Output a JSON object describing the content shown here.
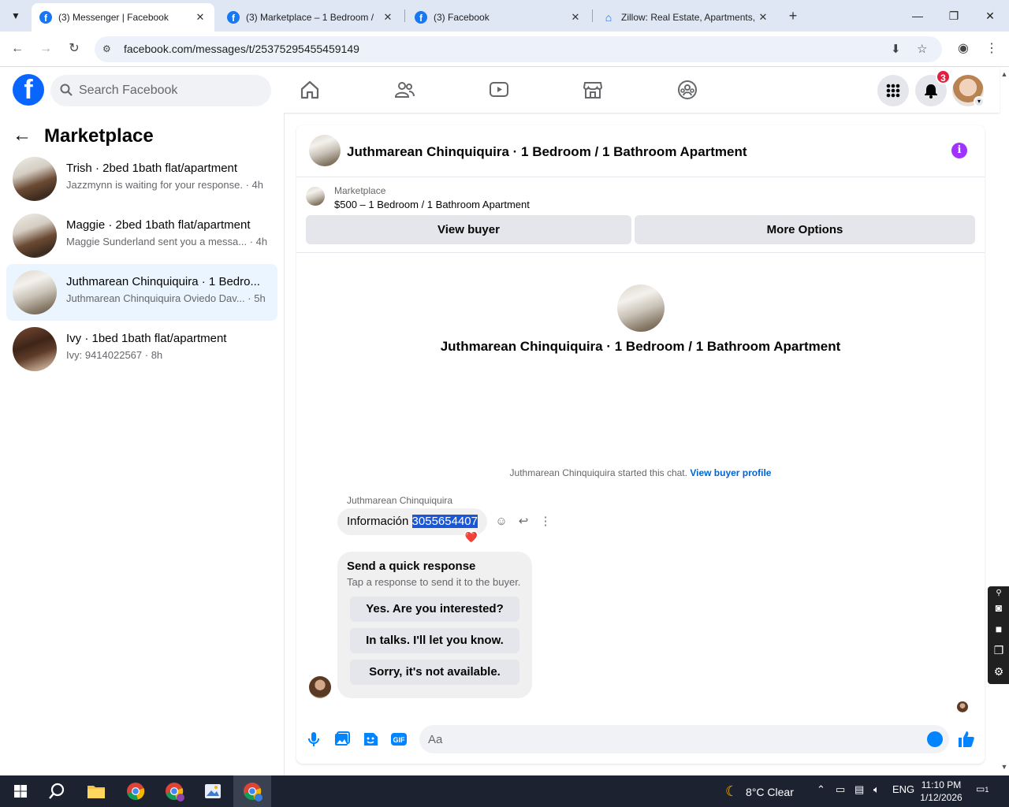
{
  "browser": {
    "tabs": [
      {
        "title": "(3) Messenger | Facebook",
        "favicon": "facebook-icon",
        "active": true
      },
      {
        "title": "(3) Marketplace – 1 Bedroom /",
        "favicon": "facebook-icon",
        "active": false
      },
      {
        "title": "(3) Facebook",
        "favicon": "facebook-icon",
        "active": false
      },
      {
        "title": "Zillow: Real Estate, Apartments,",
        "favicon": "zillow-icon",
        "active": false
      }
    ],
    "url": "facebook.com/messages/t/25375295455459149"
  },
  "fb_header": {
    "search_placeholder": "Search Facebook",
    "notification_count": "3",
    "brand_color": "#0866ff"
  },
  "sidebar": {
    "title": "Marketplace",
    "conversations": [
      {
        "name": "Trish · 2bed 1bath flat/apartment",
        "preview": "Jazzmynn is waiting for your response. · 4h"
      },
      {
        "name": "Maggie · 2bed 1bath flat/apartment",
        "preview": "Maggie Sunderland sent you a messa... · 4h"
      },
      {
        "name": "Juthmarean Chinquiquira · 1 Bedro...",
        "preview": "Juthmarean Chinquiquira Oviedo Dav... · 5h"
      },
      {
        "name": "Ivy · 1bed 1bath flat/apartment",
        "preview": "Ivy: 9414022567 · 8h"
      }
    ]
  },
  "chat": {
    "title": "Juthmarean Chinquiquira · 1 Bedroom / 1 Bathroom Apartment",
    "listing_category": "Marketplace",
    "listing_price": "$500 – 1 Bedroom / 1 Bathroom Apartment",
    "view_buyer_label": "View buyer",
    "more_options_label": "More Options",
    "center_title": "Juthmarean Chinquiquira · 1 Bedroom / 1 Bathroom Apartment",
    "started_text": "Juthmarean Chinquiquira started this chat.",
    "view_buyer_profile_label": "View buyer profile",
    "sender_name": "Juthmarean Chinquiquira",
    "message_prefix": "Información",
    "message_selected": "3055654407",
    "reaction": "❤️",
    "quick_response": {
      "title": "Send a quick response",
      "subtitle": "Tap a response to send it to the buyer.",
      "options": [
        "Yes. Are you interested?",
        "In talks. I'll let you know.",
        "Sorry, it's not available."
      ]
    },
    "composer_placeholder": "Aa",
    "accent_color": "#0084ff"
  },
  "taskbar": {
    "weather": "8°C  Clear",
    "language": "ENG",
    "time": "11:10 PM",
    "date": "1/12/2026",
    "notification_count": "1"
  }
}
